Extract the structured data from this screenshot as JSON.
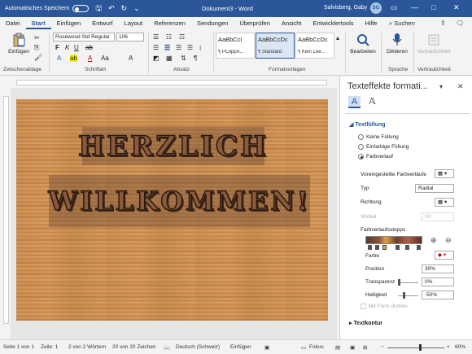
{
  "titlebar": {
    "autosave_label": "Automatisches Speichern",
    "doc_title": "Dokument3 - Word",
    "user_name": "Salvisberg, Gaby",
    "user_initials": "SG"
  },
  "menu": [
    "Datei",
    "Start",
    "Einfügen",
    "Entwurf",
    "Layout",
    "Referenzen",
    "Sendungen",
    "Überprüfen",
    "Ansicht",
    "Entwicklertools",
    "Hilfe"
  ],
  "search_label": "Suchen",
  "ribbon": {
    "paste_label": "Einfügen",
    "font_name": "Rosewood Std Regular",
    "font_size": "106",
    "styles": [
      {
        "preview": "AaBbCcI",
        "name": "¶ PClippA..."
      },
      {
        "preview": "AaBbCcDc",
        "name": "¶ Standard"
      },
      {
        "preview": "AaBbCcDc",
        "name": "¶ Kein Lee..."
      }
    ],
    "edit_label": "Bearbeiten",
    "dictate_label": "Diktieren",
    "confidential_label": "Vertraulichkeit",
    "groups": {
      "clipboard": "Zwischenablage",
      "font": "Schriftart",
      "paragraph": "Absatz",
      "styles": "Formatvorlagen",
      "voice": "Sprache",
      "confidential": "Vertraulichkeit"
    }
  },
  "document": {
    "line1": "HERZLICH",
    "line2": "WILLKOMMEN!"
  },
  "pane": {
    "title": "Texteffekte formati...",
    "section_fill": "Textfüllung",
    "options": [
      "Keine Füllung",
      "Einfarbige Füllung",
      "Farbverlauf"
    ],
    "preset_label": "Voreingestellte Farbverläufe",
    "type_label": "Typ",
    "type_value": "Radial",
    "direction_label": "Richtung",
    "angle_label": "Winkel",
    "angle_value": "90°",
    "stops_label": "Farbverlaufsstopps",
    "color_label": "Farbe",
    "position_label": "Position",
    "position_value": "30%",
    "transparency_label": "Transparenz",
    "transparency_value": "0%",
    "brightness_label": "Helligkeit",
    "brightness_value": "-50%",
    "rotate_label": "Mit Form drehen",
    "section_outline": "Textkontur"
  },
  "status": {
    "page": "Seite 1 von 1",
    "line": "Zeile: 1",
    "words": "2 von 2 Wörtern",
    "chars": "20 von 20 Zeichen",
    "language": "Deutsch (Schweiz)",
    "insert": "Einfügen",
    "focus": "Fokus",
    "zoom": "60%"
  }
}
